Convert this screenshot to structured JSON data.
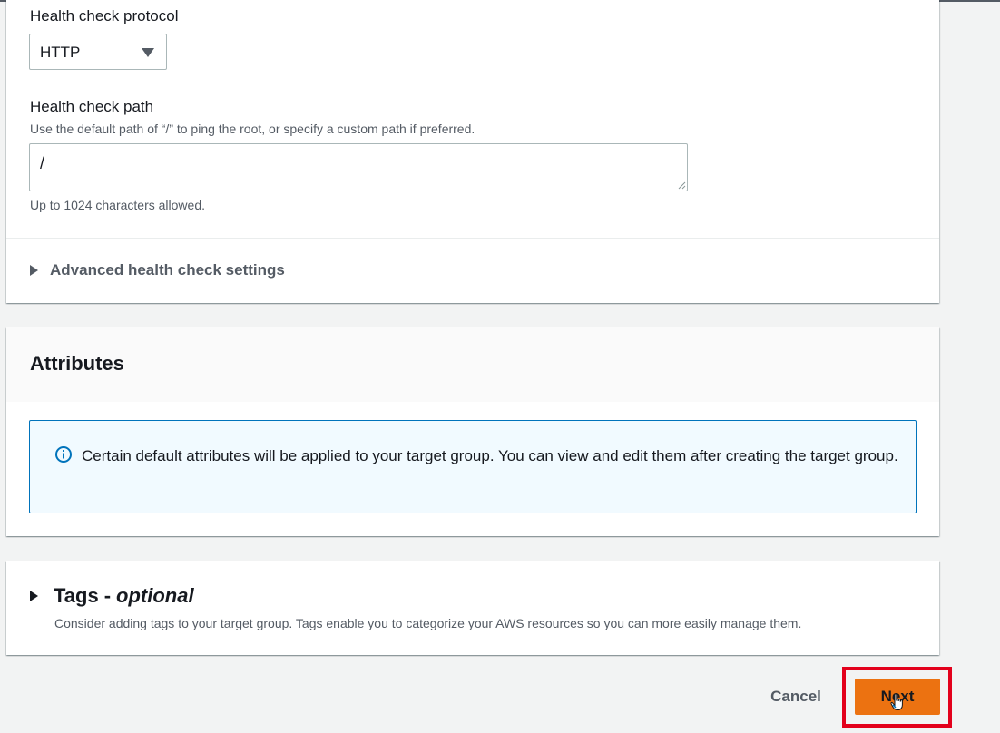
{
  "health_check": {
    "protocol_label": "Health check protocol",
    "protocol_value": "HTTP",
    "path_label": "Health check path",
    "path_description": "Use the default path of “/” to ping the root, or specify a custom path if preferred.",
    "path_value": "/",
    "path_constraint": "Up to 1024 characters allowed.",
    "advanced_label": "Advanced health check settings"
  },
  "attributes": {
    "title": "Attributes",
    "info_message": "Certain default attributes will be applied to your target group. You can view and edit them after creating the target group."
  },
  "tags": {
    "title": "Tags",
    "separator": "-",
    "optional": "optional",
    "description": "Consider adding tags to your target group. Tags enable you to categorize your AWS resources so you can more easily manage them."
  },
  "footer": {
    "cancel_label": "Cancel",
    "next_label": "Next"
  },
  "colors": {
    "primary": "#ec7211",
    "info_border": "#0073bb",
    "highlight": "#e3001b"
  }
}
